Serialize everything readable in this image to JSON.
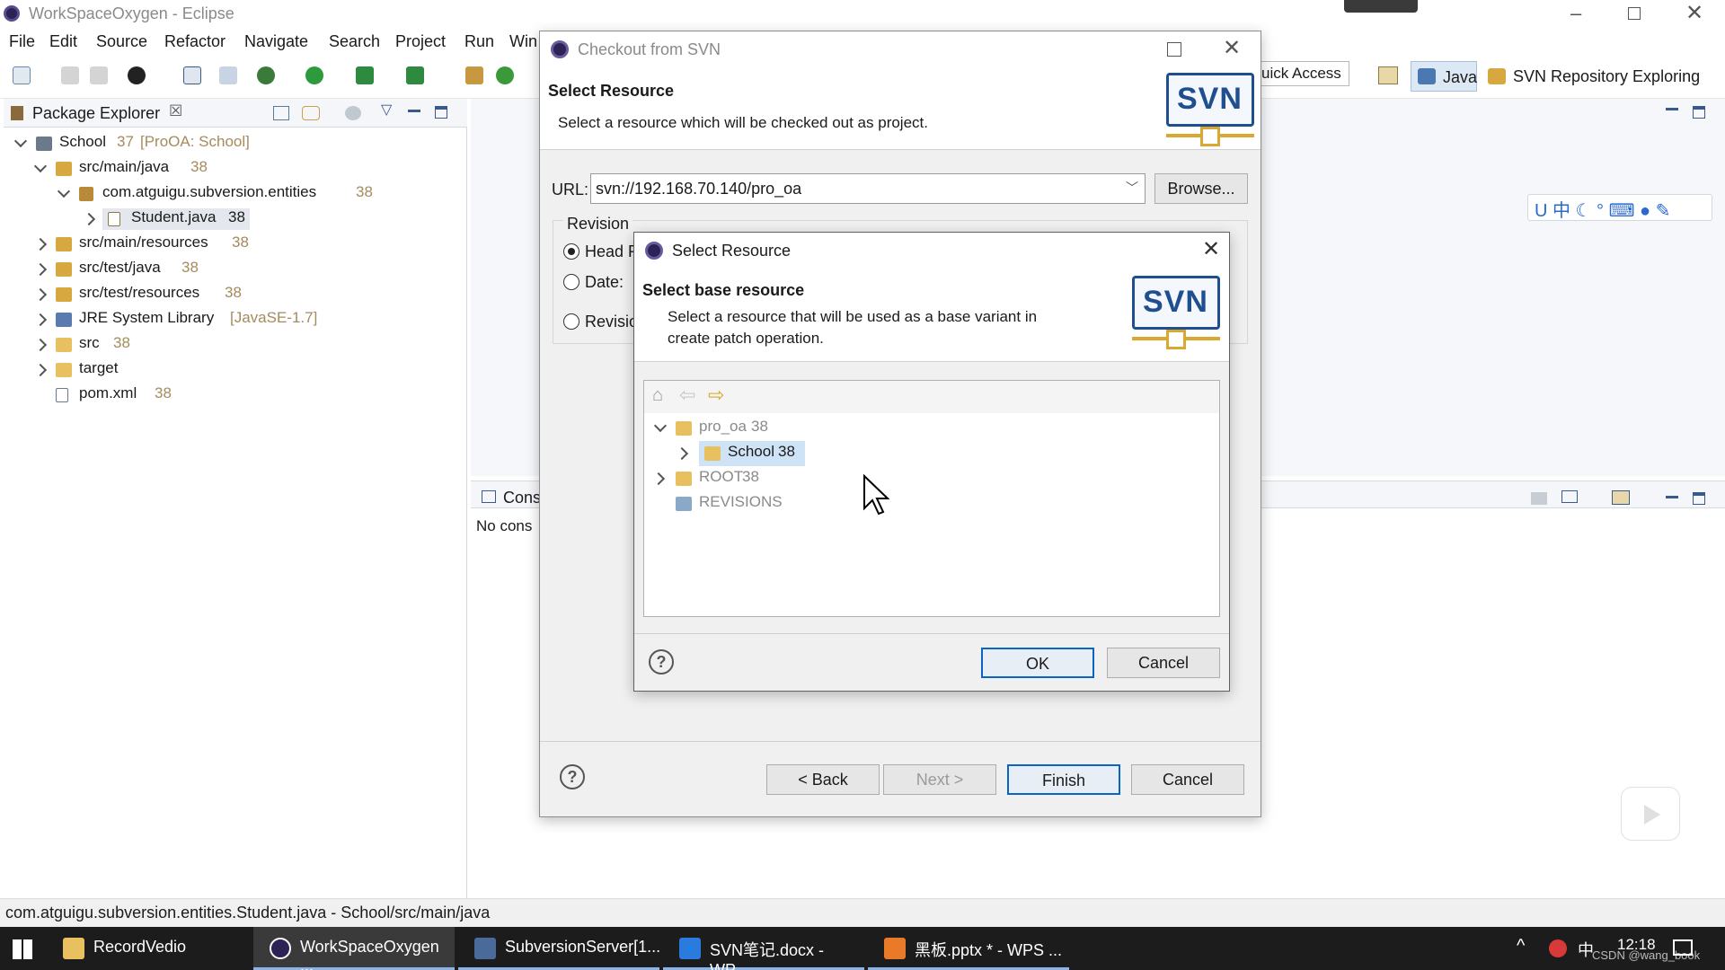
{
  "window": {
    "title": "WorkSpaceOxygen - Eclipse"
  },
  "menu": [
    "File",
    "Edit",
    "Source",
    "Refactor",
    "Navigate",
    "Search",
    "Project",
    "Run",
    "Win"
  ],
  "toolbar_right": {
    "quick_access": "uick Access",
    "perspective_java": "Java",
    "perspective_svn": "SVN Repository Exploring"
  },
  "package_explorer": {
    "tab": "Package Explorer",
    "tree": [
      {
        "label": "School",
        "rev": "37",
        "extra": "[ProOA: School]"
      },
      {
        "label": "src/main/java",
        "rev": "38"
      },
      {
        "label": "com.atguigu.subversion.entities",
        "rev": "38"
      },
      {
        "label": "Student.java",
        "rev": "38"
      },
      {
        "label": "src/main/resources",
        "rev": "38"
      },
      {
        "label": "src/test/java",
        "rev": "38"
      },
      {
        "label": "src/test/resources",
        "rev": "38"
      },
      {
        "label": "JRE System Library",
        "rev": "",
        "extra": "[JavaSE-1.7]"
      },
      {
        "label": "src",
        "rev": "38"
      },
      {
        "label": "target",
        "rev": ""
      },
      {
        "label": "pom.xml",
        "rev": "38"
      }
    ]
  },
  "console": {
    "tab": "Cons",
    "text": "No cons"
  },
  "status": {
    "text": "com.atguigu.subversion.entities.Student.java - School/src/main/java"
  },
  "checkout_dialog": {
    "title": "Checkout from SVN",
    "heading": "Select Resource",
    "description": "Select a resource which will be checked out as project.",
    "url_label": "URL:",
    "url_value": "svn://192.168.70.140/pro_oa",
    "browse": "Browse...",
    "revision_group": "Revision",
    "radio_head": "Head R",
    "radio_date": "Date:",
    "radio_revision": "Revisio",
    "back": "< Back",
    "next": "Next >",
    "finish": "Finish",
    "cancel": "Cancel",
    "logo": "SVN"
  },
  "select_dialog": {
    "title": "Select Resource",
    "heading": "Select base resource",
    "description_line1": "Select a resource that will be used as a base variant in",
    "description_line2": "create patch operation.",
    "tree": [
      {
        "label": "pro_oa",
        "rev": "38"
      },
      {
        "label": "School",
        "rev": "38"
      },
      {
        "label": "ROOT",
        "rev": "38"
      },
      {
        "label": "REVISIONS",
        "rev": ""
      }
    ],
    "ok": "OK",
    "cancel": "Cancel",
    "logo": "SVN"
  },
  "taskbar": {
    "items": [
      "RecordVedio",
      "WorkSpaceOxygen ...",
      "SubversionServer[1...",
      "SVN笔记.docx - WP...",
      "黑板.pptx * - WPS ..."
    ],
    "ime": "中",
    "clock": "12:18",
    "watermark": "CSDN @wang_book"
  },
  "colors": {
    "accent": "#0a64c8",
    "selection": "#cfe3f7",
    "svn_logo": "#1f4f8f",
    "folder": "#e8b84a"
  }
}
